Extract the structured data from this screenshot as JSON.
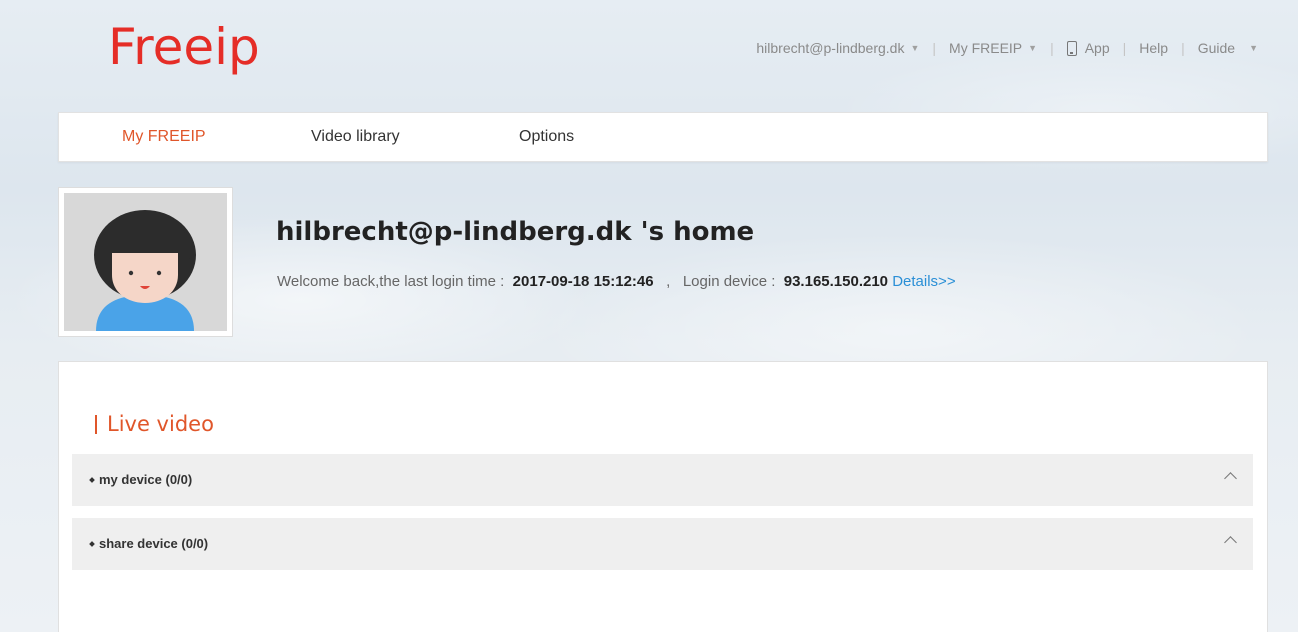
{
  "brand": {
    "logo_text": "Freeip",
    "logo_color": "#e52d27",
    "accent_color": "#e0562a",
    "link_color": "#2a8fd6"
  },
  "top_links": {
    "account": "hilbrecht@p-lindberg.dk",
    "my_freeip": "My FREEIP",
    "app": "App",
    "help": "Help",
    "guide": "Guide",
    "separator": "|",
    "caret": "▼"
  },
  "nav": {
    "tabs": [
      {
        "label": "My FREEIP",
        "active": true
      },
      {
        "label": "Video library",
        "active": false
      },
      {
        "label": "Options",
        "active": false
      }
    ]
  },
  "profile": {
    "title": "hilbrecht@p-lindberg.dk 's home",
    "welcome_text": "Welcome back,the last login time :",
    "last_login": "2017-09-18 15:12:46",
    "comma": ",",
    "device_label": "Login device :",
    "device_ip": "93.165.150.210",
    "details_link": "Details>>"
  },
  "live_video": {
    "title": "Live video",
    "rows": [
      {
        "label": "my device (0/0)",
        "icon": "chevron-up-icon"
      },
      {
        "label": "share device (0/0)",
        "icon": "chevron-up-icon"
      }
    ]
  }
}
